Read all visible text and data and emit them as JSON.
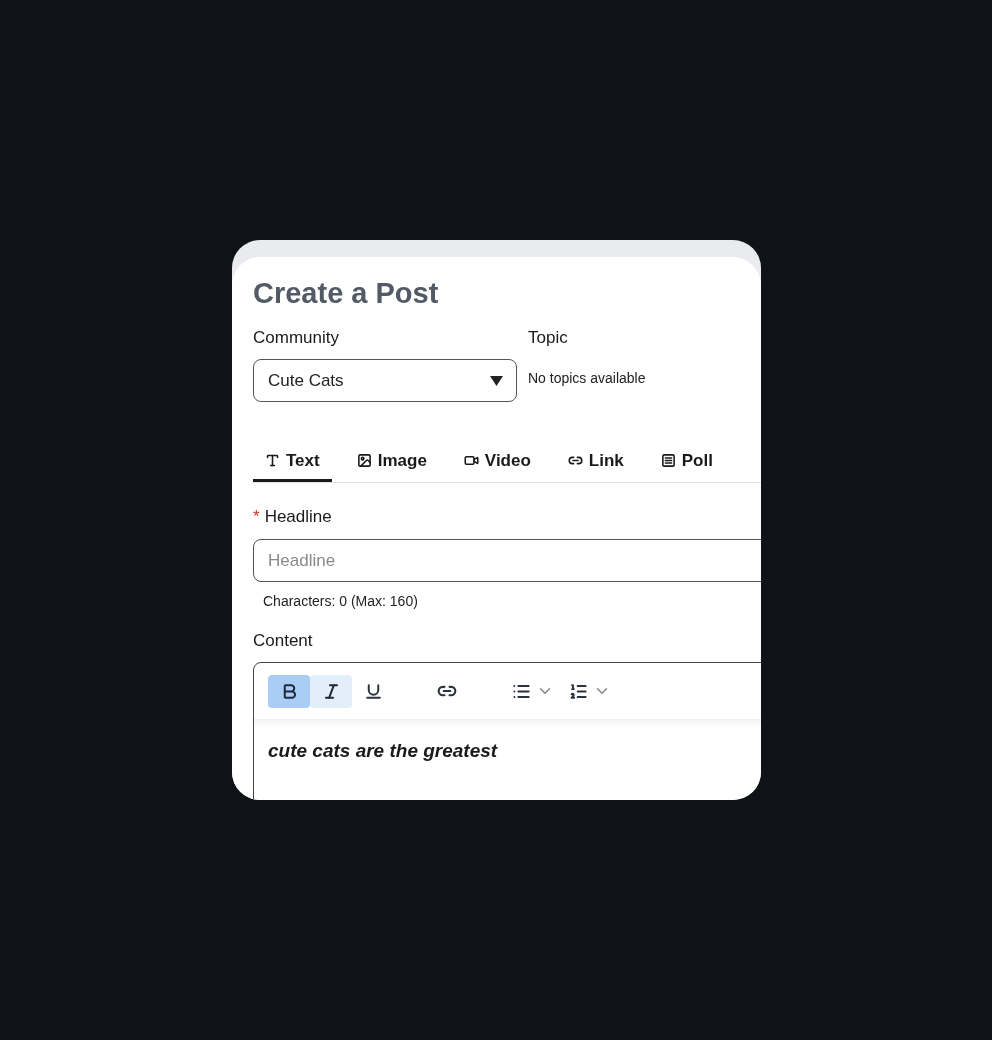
{
  "title": "Create a Post",
  "community": {
    "label": "Community",
    "value": "Cute Cats"
  },
  "topic": {
    "label": "Topic",
    "note": "No topics available"
  },
  "tabs": [
    {
      "label": "Text",
      "kind": "text",
      "selected": true
    },
    {
      "label": "Image",
      "kind": "image",
      "selected": false
    },
    {
      "label": "Video",
      "kind": "video",
      "selected": false
    },
    {
      "label": "Link",
      "kind": "link",
      "selected": false
    },
    {
      "label": "Poll",
      "kind": "poll",
      "selected": false
    }
  ],
  "headline": {
    "label": "Headline",
    "required_mark": "*",
    "placeholder": "Headline",
    "counter": "Characters: 0 (Max: 160)"
  },
  "content": {
    "label": "Content",
    "toolbar": [
      {
        "kind": "bold",
        "selected": true,
        "color": "#a9cdf5"
      },
      {
        "kind": "italic",
        "selected": true,
        "color": "#e3eefb"
      },
      {
        "kind": "underline",
        "selected": false
      },
      {
        "kind": "link",
        "selected": false
      },
      {
        "kind": "bullets",
        "selected": false
      },
      {
        "kind": "numbers",
        "selected": false
      }
    ],
    "text": "cute cats are the greatest"
  }
}
